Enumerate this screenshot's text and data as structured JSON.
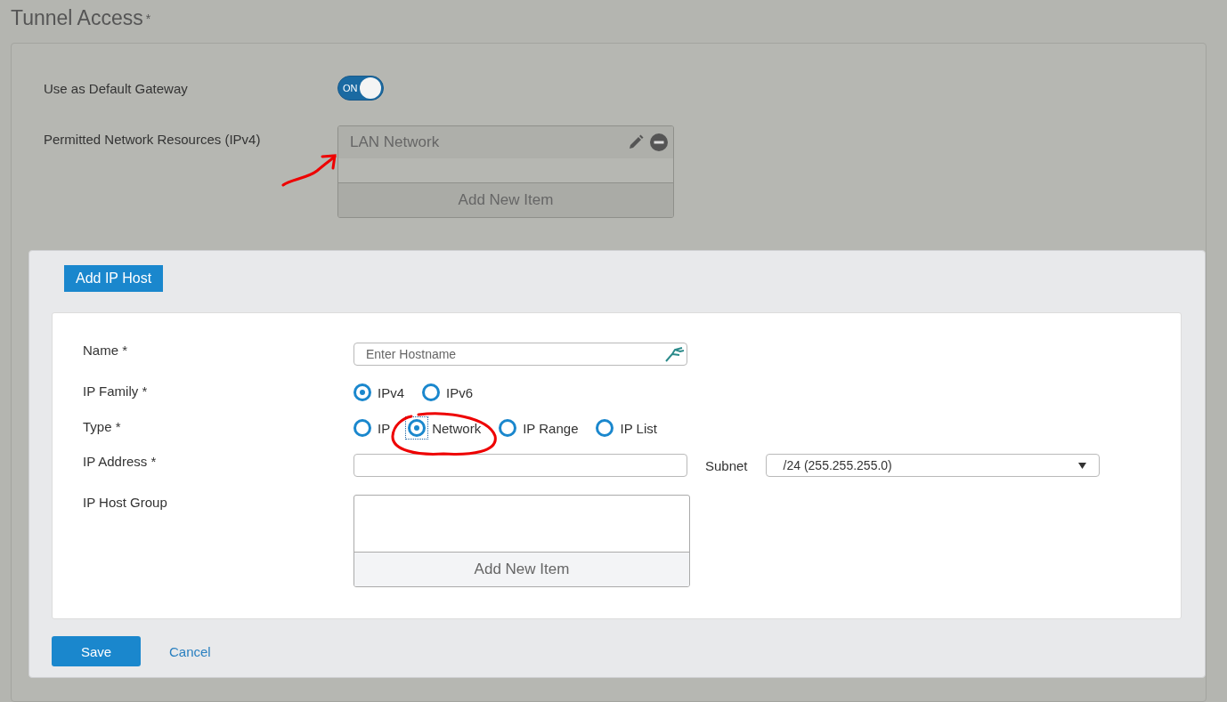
{
  "page": {
    "title": "Tunnel Access",
    "title_mark": "*"
  },
  "settings": {
    "gateway": {
      "label": "Use as Default Gateway",
      "on": true,
      "toggle_text": "ON"
    },
    "resources": {
      "label": "Permitted Network Resources (IPv4)",
      "items": [
        {
          "name": "LAN Network"
        }
      ],
      "add_text": "Add New Item"
    }
  },
  "dialog": {
    "title": "Add IP Host",
    "fields": [
      {
        "kind": "text",
        "label": "Name",
        "mark": "*",
        "placeholder": "Enter Hostname"
      },
      {
        "kind": "radio",
        "label": "IP Family",
        "mark": "*",
        "options": [
          {
            "label": "IPv4",
            "selected": true,
            "focused": false
          },
          {
            "label": "IPv6",
            "selected": false,
            "focused": false
          }
        ]
      },
      {
        "kind": "radio",
        "label": "Type",
        "mark": "*",
        "options": [
          {
            "label": "IP",
            "selected": false,
            "focused": false
          },
          {
            "label": "Network",
            "selected": true,
            "focused": true
          },
          {
            "label": "IP Range",
            "selected": false,
            "focused": false
          },
          {
            "label": "IP List",
            "selected": false,
            "focused": false
          }
        ]
      },
      {
        "kind": "address",
        "label": "IP Address",
        "mark": "*",
        "subnet_label": "Subnet",
        "subnet_value": "/24 (255.255.255.0)"
      },
      {
        "kind": "list",
        "label": "IP Host Group",
        "add_text": "Add New Item"
      }
    ],
    "buttons": {
      "save": "Save",
      "cancel": "Cancel"
    }
  }
}
